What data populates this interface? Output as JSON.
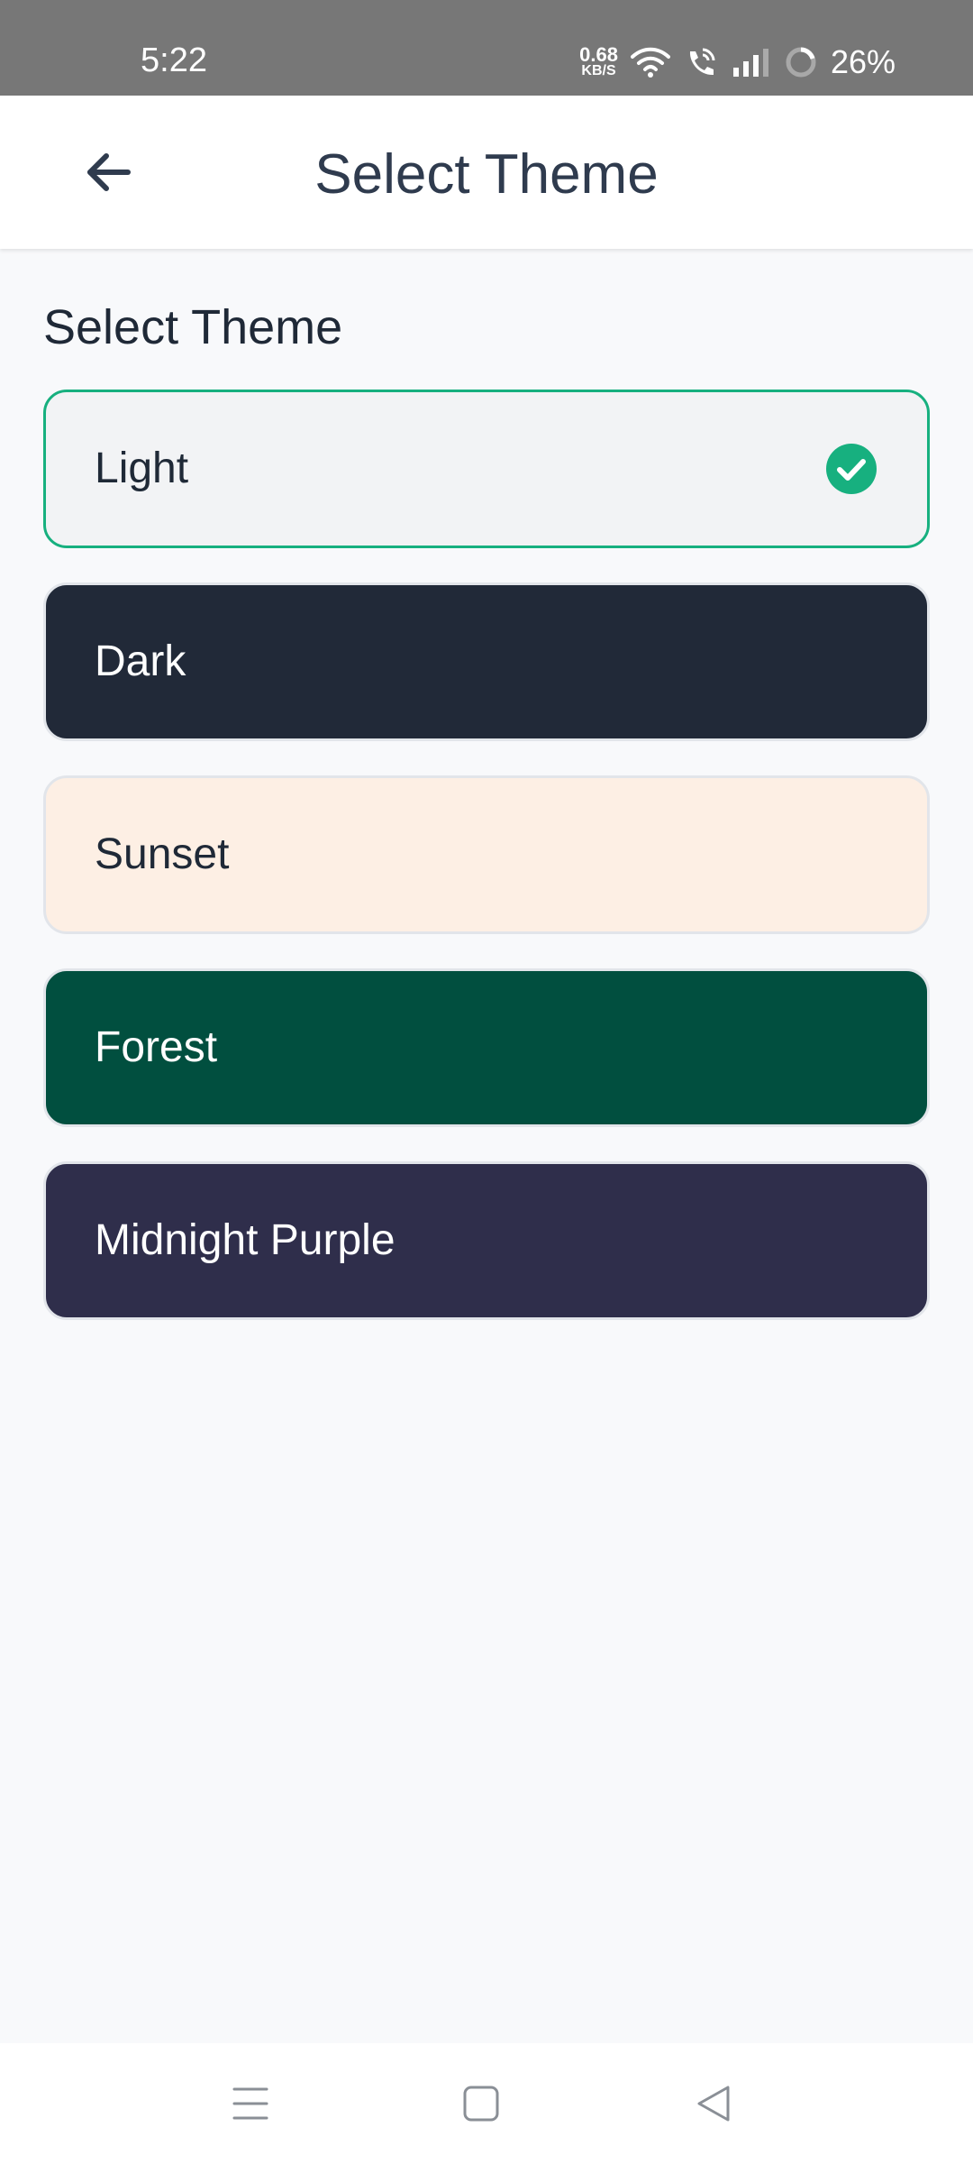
{
  "status_bar": {
    "time": "5:22",
    "net_speed": "0.68",
    "net_unit": "KB/S",
    "battery": "26%"
  },
  "app_bar": {
    "title": "Select Theme"
  },
  "content": {
    "section_title": "Select Theme",
    "themes": [
      {
        "label": "Light",
        "selected": true,
        "bg": "#f2f3f5",
        "text": "#1f2937"
      },
      {
        "label": "Dark",
        "selected": false,
        "bg": "#212938",
        "text": "#ffffff"
      },
      {
        "label": "Sunset",
        "selected": false,
        "bg": "#fdefe4",
        "text": "#1f2937"
      },
      {
        "label": "Forest",
        "selected": false,
        "bg": "#014f3f",
        "text": "#ffffff"
      },
      {
        "label": "Midnight Purple",
        "selected": false,
        "bg": "#2f2e4b",
        "text": "#ffffff"
      }
    ]
  },
  "colors": {
    "accent": "#17b07f",
    "title": "#2f3b4e",
    "background": "#f8f9fb"
  },
  "icons": {
    "back": "arrow-left-icon",
    "check": "check-circle-icon",
    "nav_menu": "menu-icon",
    "nav_home": "square-home-icon",
    "nav_back": "triangle-back-icon"
  }
}
